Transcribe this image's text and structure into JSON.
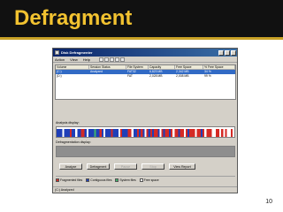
{
  "slide": {
    "title": "Defragment",
    "page_number": "10"
  },
  "window": {
    "title": "Disk Defragmenter",
    "menu": [
      "Action",
      "View",
      "Help"
    ]
  },
  "volumes": {
    "columns": [
      "Volume",
      "Session Status",
      "File System",
      "Capacity",
      "Free Space",
      "% Free Space"
    ],
    "rows": [
      [
        "(C:)",
        "Analyzed",
        "FAT32",
        "6,823 MB",
        "2,342 MB",
        "34 %"
      ],
      [
        "(D:)",
        "",
        "FAT",
        "2,028 MB",
        "2,008 MB",
        "99 %"
      ]
    ]
  },
  "analysis": {
    "label": "Analysis display:",
    "colors": {
      "fragmented": "#d42a24",
      "contiguous": "#1f3fb8",
      "system": "#3fb46a",
      "free": "#ffffff"
    },
    "stripes": [
      "c",
      "c",
      "c",
      "f",
      "c",
      "c",
      "c",
      "r",
      "c",
      "c",
      "f",
      "c",
      "c",
      "r",
      "r",
      "c",
      "f",
      "c",
      "c",
      "c",
      "s",
      "c",
      "c",
      "r",
      "c",
      "f",
      "c",
      "c",
      "c",
      "r",
      "c",
      "c",
      "c",
      "f",
      "r",
      "c",
      "c",
      "c",
      "r",
      "r",
      "f",
      "c",
      "c",
      "r",
      "c",
      "r",
      "c",
      "f",
      "r",
      "c",
      "r",
      "c",
      "r",
      "r",
      "c",
      "f",
      "r",
      "c",
      "r",
      "r",
      "c",
      "r",
      "f",
      "r",
      "r",
      "c",
      "r",
      "r",
      "f",
      "r",
      "c",
      "r",
      "r",
      "r",
      "f",
      "r",
      "r",
      "c",
      "r",
      "f",
      "r",
      "r",
      "r",
      "f",
      "f",
      "r",
      "r",
      "f",
      "r",
      "f",
      "r",
      "f",
      "f",
      "r",
      "f"
    ]
  },
  "defrag_display": {
    "label": "Defragmentation display:",
    "color": "#8e8e8e"
  },
  "buttons": [
    "Analyze",
    "Defragment",
    "Pause",
    "Stop",
    "View Report"
  ],
  "legend": {
    "items": [
      {
        "label": "Fragmented files",
        "color": "#d42a24"
      },
      {
        "label": "Contiguous files",
        "color": "#1f3fb8"
      },
      {
        "label": "System files",
        "color": "#3fb46a"
      },
      {
        "label": "Free space",
        "color": "#ffffff"
      }
    ]
  },
  "status_bar": "(C:) Analyzed"
}
